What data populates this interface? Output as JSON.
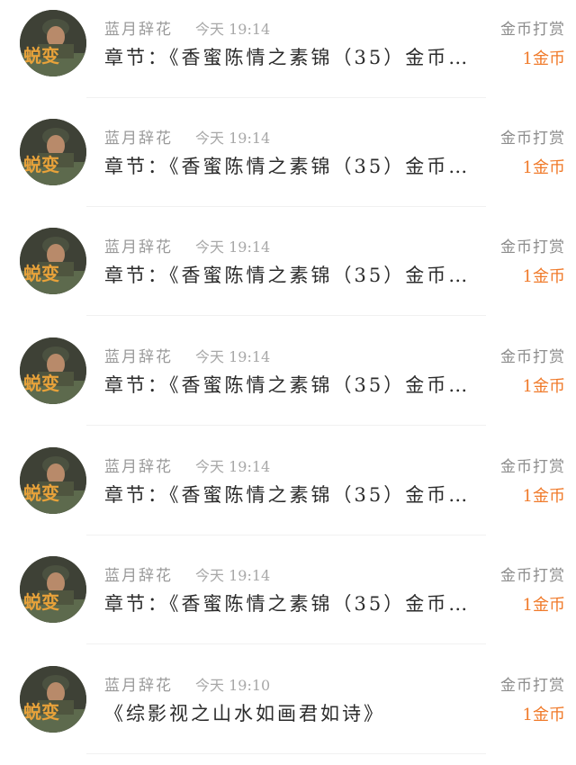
{
  "items": [
    {
      "name": "蓝月辞花",
      "time": "今天 19:14",
      "content": "章节：《香蜜陈情之素锦（35）金币…",
      "tip_label": "金币打赏",
      "tip_amount": "1金币"
    },
    {
      "name": "蓝月辞花",
      "time": "今天 19:14",
      "content": "章节：《香蜜陈情之素锦（35）金币…",
      "tip_label": "金币打赏",
      "tip_amount": "1金币"
    },
    {
      "name": "蓝月辞花",
      "time": "今天 19:14",
      "content": "章节：《香蜜陈情之素锦（35）金币…",
      "tip_label": "金币打赏",
      "tip_amount": "1金币"
    },
    {
      "name": "蓝月辞花",
      "time": "今天 19:14",
      "content": "章节：《香蜜陈情之素锦（35）金币…",
      "tip_label": "金币打赏",
      "tip_amount": "1金币"
    },
    {
      "name": "蓝月辞花",
      "time": "今天 19:14",
      "content": "章节：《香蜜陈情之素锦（35）金币…",
      "tip_label": "金币打赏",
      "tip_amount": "1金币"
    },
    {
      "name": "蓝月辞花",
      "time": "今天 19:14",
      "content": "章节：《香蜜陈情之素锦（35）金币…",
      "tip_label": "金币打赏",
      "tip_amount": "1金币"
    },
    {
      "name": "蓝月辞花",
      "time": "今天 19:10",
      "content": "《综影视之山水如画君如诗》",
      "tip_label": "金币打赏",
      "tip_amount": "1金币"
    }
  ],
  "avatar_text": "蜕变",
  "colors": {
    "accent": "#f07a2a",
    "name": "#9a9a9a",
    "content": "#2b2b2b"
  }
}
